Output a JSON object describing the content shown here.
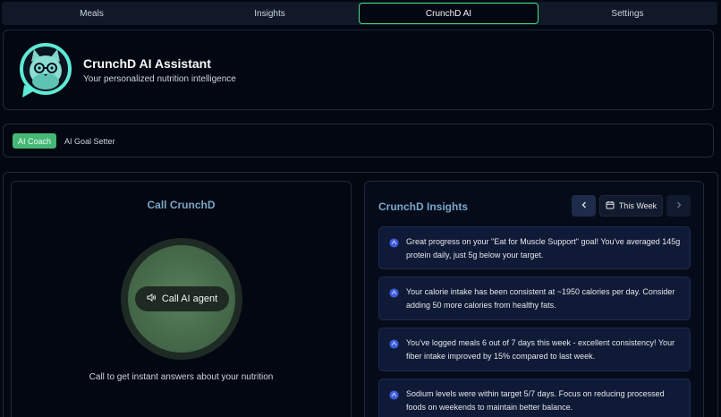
{
  "tabs": [
    {
      "label": "Meals"
    },
    {
      "label": "Insights"
    },
    {
      "label": "CrunchD AI",
      "active": true
    },
    {
      "label": "Settings"
    }
  ],
  "header": {
    "title": "CrunchD AI Assistant",
    "subtitle": "Your personalized nutrition intelligence",
    "avatar_icon": "cat-glasses-avatar"
  },
  "subtabs": [
    {
      "label": "AI Coach",
      "active": true
    },
    {
      "label": "AI Goal Setter"
    }
  ],
  "call": {
    "title": "Call CrunchD",
    "button_label": "Call AI agent",
    "button_icon": "speaker-icon",
    "hint": "Call to get instant answers about your nutrition"
  },
  "insights": {
    "title": "CrunchD Insights",
    "period_label": "This Week",
    "items": [
      {
        "text": "Great progress on your \"Eat for Muscle Support\" goal! You've averaged 145g protein daily, just 5g below your target."
      },
      {
        "text": "Your calorie intake has been consistent at ~1950 calories per day. Consider adding 50 more calories from healthy fats."
      },
      {
        "text": "You've logged meals 6 out of 7 days this week - excellent consistency! Your fiber intake improved by 15% compared to last week."
      },
      {
        "text": "Sodium levels were within target 5/7 days. Focus on reducing processed foods on weekends to maintain better balance."
      }
    ]
  },
  "colors": {
    "accent_green": "#4ade80",
    "title_blue": "#7aa7c7",
    "card_bg": "#0f1a36"
  }
}
